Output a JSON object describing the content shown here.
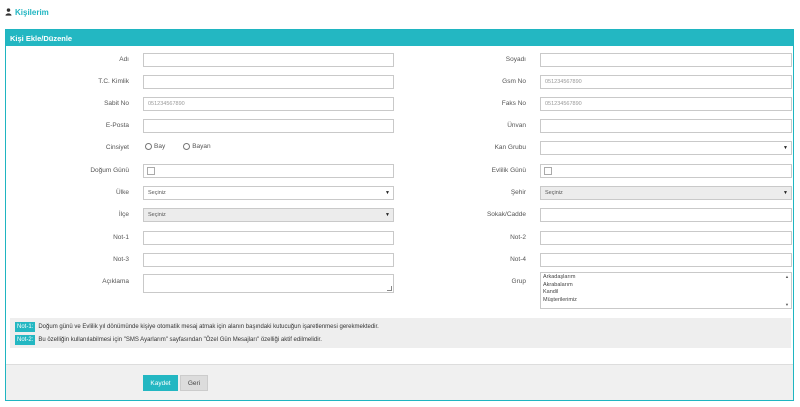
{
  "page": {
    "title": "Kişilerim",
    "icon": "user-icon"
  },
  "panel": {
    "title": "Kişi Ekle/Düzenle"
  },
  "form": {
    "first_name": {
      "label": "Adı",
      "value": ""
    },
    "last_name": {
      "label": "Soyadı",
      "value": ""
    },
    "tc": {
      "label": "T.C. Kimlik",
      "value": ""
    },
    "gsm": {
      "label": "Gsm No",
      "placeholder": "051234567890"
    },
    "phone": {
      "label": "Sabit No",
      "placeholder": "051234567890"
    },
    "fax": {
      "label": "Faks No",
      "placeholder": "051234567890"
    },
    "email": {
      "label": "E-Posta",
      "value": ""
    },
    "title_field": {
      "label": "Ünvan",
      "value": ""
    },
    "gender": {
      "label": "Cinsiyet",
      "options": [
        "Bay",
        "Bayan"
      ]
    },
    "blood": {
      "label": "Kan Grubu",
      "value": ""
    },
    "birthday": {
      "label": "Doğum Günü"
    },
    "anniversary": {
      "label": "Evlilik Günü"
    },
    "country": {
      "label": "Ülke",
      "value": "Seçiniz"
    },
    "city": {
      "label": "Şehir",
      "value": "Seçiniz"
    },
    "district": {
      "label": "İlçe",
      "value": "Seçiniz"
    },
    "street": {
      "label": "Sokak/Cadde",
      "value": ""
    },
    "note1": {
      "label": "Not-1"
    },
    "note2": {
      "label": "Not-2"
    },
    "note3": {
      "label": "Not-3"
    },
    "note4": {
      "label": "Not-4"
    },
    "description": {
      "label": "Açıklama"
    },
    "group": {
      "label": "Grup",
      "options": [
        "Arkadaşlarım",
        "Akrabalarım",
        "Kandil",
        "Müşterilerimiz"
      ]
    }
  },
  "notes": [
    {
      "tag": "Not-1:",
      "text": "Doğum günü ve Evlilik yıl dönümünde kişiye otomatik mesaj atmak için alanın başındaki kutucuğun işaretlenmesi gerekmektedir."
    },
    {
      "tag": "Not-2:",
      "text": "Bu özelliğin kullanılabilmesi için \"SMS Ayarlarım\" sayfasından \"Özel Gün Mesajları\" özelliği aktif edilmelidir."
    }
  ],
  "buttons": {
    "save": "Kaydet",
    "back": "Geri"
  }
}
